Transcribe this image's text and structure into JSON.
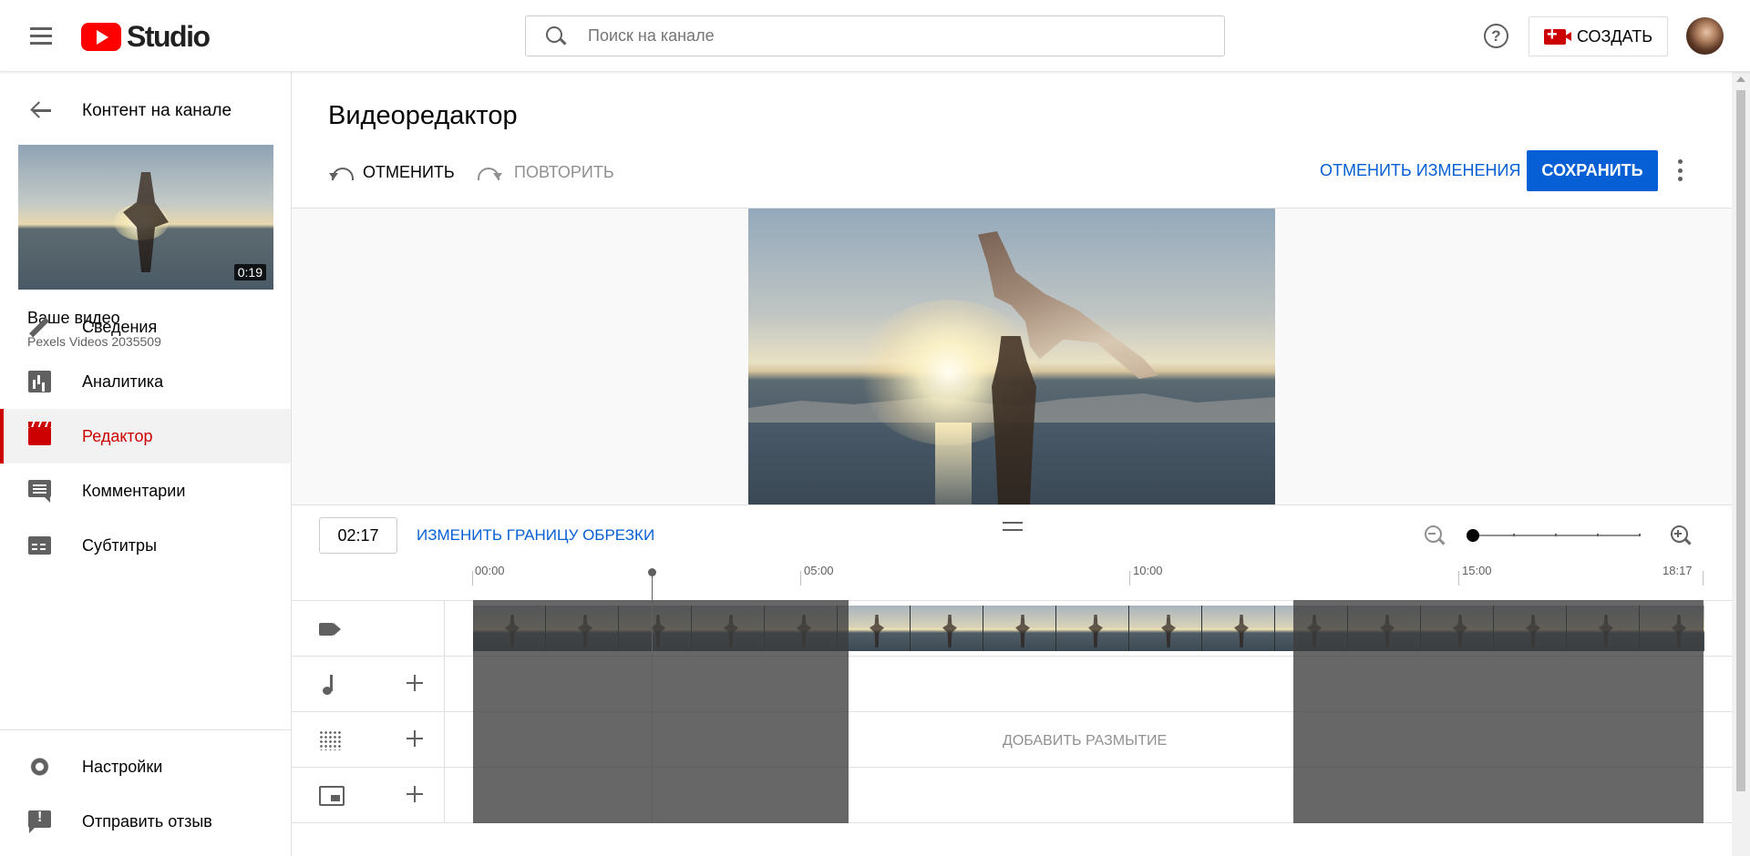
{
  "header": {
    "logo_text": "Studio",
    "search_placeholder": "Поиск на канале",
    "help_icon": "?",
    "create_label": "СОЗДАТЬ"
  },
  "sidebar": {
    "back_label": "Контент на канале",
    "thumbnail_duration": "0:19",
    "your_video_label": "Ваше видео",
    "video_filename": "Pexels Videos 2035509",
    "items": [
      {
        "label": "Сведения",
        "icon": "pencil-icon",
        "active": false
      },
      {
        "label": "Аналитика",
        "icon": "analytics-icon",
        "active": false
      },
      {
        "label": "Редактор",
        "icon": "editor-icon",
        "active": true
      },
      {
        "label": "Комментарии",
        "icon": "comment-icon",
        "active": false
      },
      {
        "label": "Субтитры",
        "icon": "subtitles-icon",
        "active": false
      }
    ],
    "bottom_items": [
      {
        "label": "Настройки",
        "icon": "gear-icon"
      },
      {
        "label": "Отправить отзыв",
        "icon": "feedback-icon"
      }
    ]
  },
  "editor": {
    "title": "Видеоредактор",
    "undo_label": "ОТМЕНИТЬ",
    "redo_label": "ПОВТОРИТЬ",
    "discard_label": "ОТМЕНИТЬ ИЗМЕНЕНИЯ",
    "save_label": "СОХРАНИТЬ",
    "timecode": "02:17",
    "trim_label": "ИЗМЕНИТЬ ГРАНИЦУ ОБРЕЗКИ",
    "ruler": [
      "00:00",
      "05:00",
      "10:00",
      "15:00",
      "18:17"
    ],
    "blur_label": "ДОБАВИТЬ РАЗМЫТИЕ"
  },
  "colors": {
    "brand_red": "#cc0000",
    "accent_blue": "#065fd4"
  }
}
